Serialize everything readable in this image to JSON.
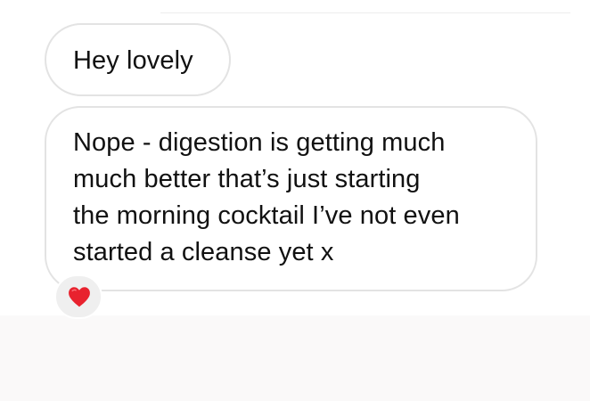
{
  "conversation": {
    "messages": [
      {
        "lines": [
          "Hey lovely"
        ]
      },
      {
        "lines": [
          "Nope - digestion is getting much",
          "much better that’s just starting",
          "the morning cocktail I’ve not even",
          "started a cleanse yet x"
        ],
        "reaction": {
          "icon": "red-heart-icon",
          "color": "#e8222e"
        }
      }
    ]
  },
  "colors": {
    "chat_background": "#ffffff",
    "page_background": "#faf9f9",
    "bubble_border": "#e3e3e3",
    "text": "#111111"
  }
}
